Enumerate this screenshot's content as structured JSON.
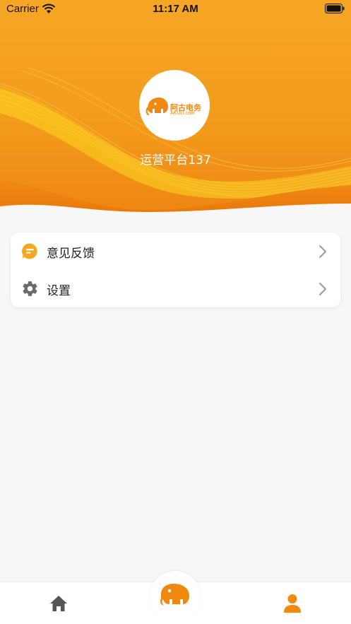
{
  "status_bar": {
    "carrier": "Carrier",
    "time": "11:17 AM"
  },
  "profile": {
    "logo_text_cn": "阿古电务",
    "logo_text_en": "AKUU.com",
    "username": "运营平台137"
  },
  "menu": {
    "items": [
      {
        "label": "意见反馈",
        "icon": "feedback-chat-icon"
      },
      {
        "label": "设置",
        "icon": "gear-icon"
      }
    ]
  },
  "tabbar": {
    "items": [
      {
        "icon": "home-icon",
        "active": false
      },
      {
        "icon": "elephant-logo-icon",
        "active": false
      },
      {
        "icon": "person-icon",
        "active": true
      }
    ]
  },
  "colors": {
    "brand_orange": "#f39a1c",
    "brand_dark_orange": "#ec7a0c",
    "tab_active": "#f08a0f",
    "tab_inactive": "#555555",
    "background": "#f7f7f7"
  }
}
